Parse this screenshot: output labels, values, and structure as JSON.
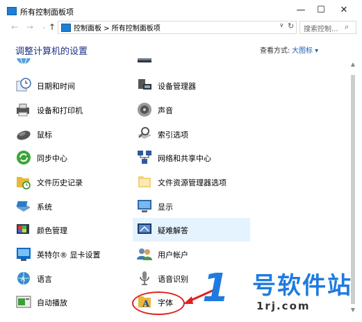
{
  "window": {
    "title": "所有控制面板项"
  },
  "controls": {
    "minimize": "—",
    "maximize": "☐",
    "close": "✕"
  },
  "nav": {
    "back": "←",
    "forward": "→",
    "dropdown": "⌄",
    "up": "↑",
    "address": "控制面板 > 所有控制面板项",
    "address_dropdown": "∨",
    "refresh": "↻",
    "search_placeholder": "搜索控制...",
    "search_icon": "⌕"
  },
  "header": {
    "title": "调整计算机的设置",
    "view_label": "查看方式:",
    "view_value": "大图标 ▾"
  },
  "left_items": [
    {
      "label": "日期和时间",
      "icon": "clock-icon"
    },
    {
      "label": "设备和打印机",
      "icon": "printer-icon"
    },
    {
      "label": "鼠标",
      "icon": "mouse-icon"
    },
    {
      "label": "同步中心",
      "icon": "sync-icon"
    },
    {
      "label": "文件历史记录",
      "icon": "file-history-icon"
    },
    {
      "label": "系统",
      "icon": "system-icon"
    },
    {
      "label": "颜色管理",
      "icon": "color-management-icon"
    },
    {
      "label": "英特尔® 显卡设置",
      "icon": "intel-graphics-icon"
    },
    {
      "label": "语言",
      "icon": "language-icon"
    },
    {
      "label": "自动播放",
      "icon": "autoplay-icon"
    }
  ],
  "right_items": [
    {
      "label": "设备管理器",
      "icon": "device-manager-icon"
    },
    {
      "label": "声音",
      "icon": "speaker-icon"
    },
    {
      "label": "索引选项",
      "icon": "indexing-icon"
    },
    {
      "label": "网络和共享中心",
      "icon": "network-icon"
    },
    {
      "label": "文件资源管理器选项",
      "icon": "folder-options-icon"
    },
    {
      "label": "显示",
      "icon": "display-icon"
    },
    {
      "label": "疑难解答",
      "icon": "troubleshoot-icon"
    },
    {
      "label": "用户帐户",
      "icon": "user-accounts-icon"
    },
    {
      "label": "语音识别",
      "icon": "microphone-icon"
    },
    {
      "label": "字体",
      "icon": "fonts-icon"
    }
  ],
  "watermark": {
    "logo": "1",
    "name": "号软件站",
    "url": "1rj.com"
  }
}
